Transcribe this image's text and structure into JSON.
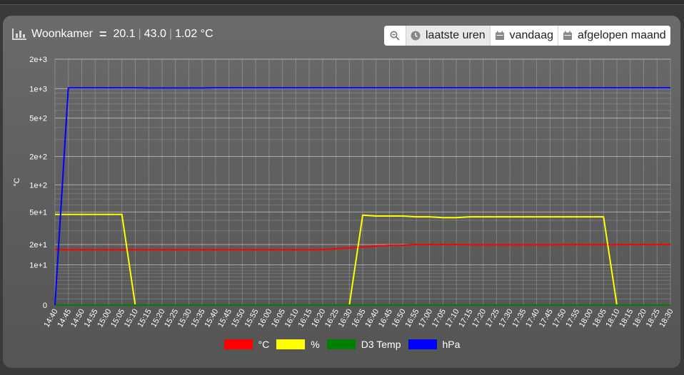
{
  "header": {
    "title": "Woonkamer",
    "values": [
      "20.1",
      "43.0",
      "1.02 °C"
    ]
  },
  "range_buttons": [
    {
      "label": "laatste uren",
      "icon": "clock-icon",
      "active": true
    },
    {
      "label": "vandaag",
      "icon": "calendar-icon",
      "active": false
    },
    {
      "label": "afgelopen maand",
      "icon": "calendar-icon",
      "active": false
    }
  ],
  "colors": {
    "°C": "#ff0000",
    "%": "#ffff00",
    "D3 Temp": "#008000",
    "hPa": "#0000ff"
  },
  "chart_data": {
    "type": "line",
    "yscale": "log",
    "ylabel": "°C",
    "yticks": [
      {
        "value": 0,
        "label": "0"
      },
      {
        "value": 10,
        "label": "1e+1"
      },
      {
        "value": 20,
        "label": "2e+1"
      },
      {
        "value": 50,
        "label": "5e+1"
      },
      {
        "value": 100,
        "label": "1e+2"
      },
      {
        "value": 200,
        "label": "2e+2"
      },
      {
        "value": 500,
        "label": "5e+2"
      },
      {
        "value": 1000,
        "label": "1e+3"
      },
      {
        "value": 2000,
        "label": "2e+3"
      }
    ],
    "x": [
      "14:40",
      "14:45",
      "14:50",
      "14:55",
      "15:00",
      "15:05",
      "15:10",
      "15:15",
      "15:20",
      "15:25",
      "15:30",
      "15:35",
      "15:40",
      "15:45",
      "15:50",
      "15:55",
      "16:00",
      "16:05",
      "16:10",
      "16:15",
      "16:20",
      "16:25",
      "16:30",
      "16:35",
      "16:40",
      "16:45",
      "16:50",
      "16:55",
      "17:00",
      "17:05",
      "17:10",
      "17:15",
      "17:20",
      "17:25",
      "17:30",
      "17:35",
      "17:40",
      "17:45",
      "17:50",
      "17:55",
      "18:00",
      "18:05",
      "18:10",
      "18:15",
      "18:20",
      "18:25",
      "18:30"
    ],
    "grid": true,
    "legend_position": "bottom",
    "series": [
      {
        "name": "°C",
        "values": [
          17,
          17,
          17,
          17,
          17,
          17,
          17,
          17,
          17,
          17,
          17,
          17,
          17,
          17,
          17,
          17,
          17,
          17,
          17,
          17,
          17,
          17.5,
          18,
          18.5,
          19,
          19.5,
          19.5,
          20,
          20,
          20,
          20,
          19.8,
          19.8,
          19.8,
          19.8,
          19.8,
          19.8,
          19.8,
          19.9,
          19.9,
          19.9,
          19.9,
          19.9,
          20,
          20,
          20,
          20
        ]
      },
      {
        "name": "%",
        "values": [
          47,
          47,
          47,
          47,
          47,
          47,
          0,
          0,
          0,
          0,
          0,
          0,
          0,
          0,
          0,
          0,
          0,
          0,
          0,
          0,
          0,
          0,
          0,
          46,
          45,
          45,
          45,
          44,
          44,
          43,
          43,
          44,
          44,
          44,
          44,
          44,
          44,
          44,
          44,
          44,
          44,
          44,
          0,
          0,
          0,
          0,
          0
        ]
      },
      {
        "name": "D3 Temp",
        "values": [
          0,
          0,
          0,
          0,
          0,
          0,
          0,
          0,
          0,
          0,
          0,
          0,
          0,
          0,
          0,
          0,
          0,
          0,
          0,
          0,
          0,
          0,
          0,
          0,
          0,
          0,
          0,
          0,
          0,
          0,
          0,
          0,
          0,
          0,
          0,
          0,
          0,
          0,
          0,
          0,
          0,
          0,
          0,
          0,
          0,
          0,
          0
        ]
      },
      {
        "name": "hPa",
        "values": [
          0,
          1020,
          1020,
          1020,
          1020,
          1020,
          1020,
          1015,
          1015,
          1015,
          1015,
          1015,
          1018,
          1018,
          1018,
          1018,
          1018,
          1018,
          1018,
          1018,
          1018,
          1018,
          1018,
          1018,
          1018,
          1018,
          1018,
          1018,
          1018,
          1018,
          1018,
          1018,
          1018,
          1018,
          1018,
          1018,
          1018,
          1018,
          1018,
          1018,
          1020,
          1020,
          1020,
          1020,
          1020,
          1020,
          1020
        ]
      }
    ]
  }
}
